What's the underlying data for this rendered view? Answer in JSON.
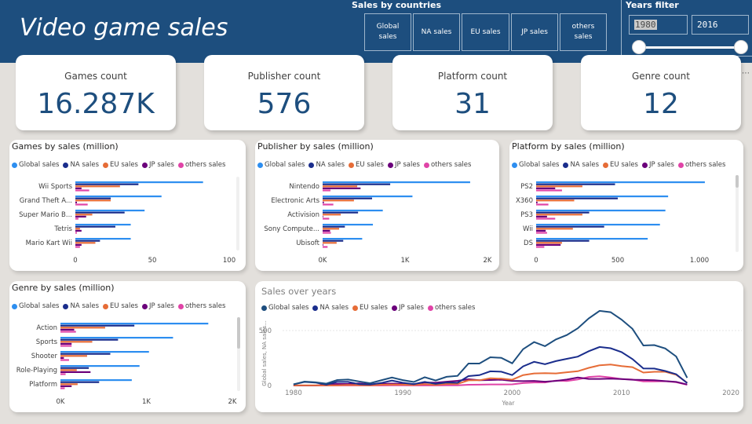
{
  "header": {
    "title": "Video game sales",
    "sales_by_countries": {
      "title": "Sales by countries",
      "buttons": [
        "Global\nsales",
        "NA sales",
        "EU sales",
        "JP sales",
        "others\nsales"
      ]
    },
    "years_filter": {
      "title": "Years filter",
      "from": "1980",
      "to": "2016"
    }
  },
  "kpis": [
    {
      "label": "Games count",
      "value": "16.287K"
    },
    {
      "label": "Publisher count",
      "value": "576"
    },
    {
      "label": "Platform count",
      "value": "31"
    },
    {
      "label": "Genre count",
      "value": "12"
    }
  ],
  "colors": {
    "global": "#2d8ef0",
    "na": "#1a2d8c",
    "eu": "#e66c37",
    "jp": "#6b007b",
    "others": "#e044a7",
    "line_global": "#1d4e7e"
  },
  "legend": [
    "Global sales",
    "NA sales",
    "EU sales",
    "JP sales",
    "others sales"
  ],
  "chart_data": [
    {
      "type": "bar",
      "title": "Games by sales (million)",
      "categories": [
        "Wii Sports",
        "Grand Theft A...",
        "Super Mario B...",
        "Tetris",
        "Mario Kart Wii"
      ],
      "series": [
        {
          "name": "Global sales",
          "values": [
            83,
            56,
            45,
            36,
            36
          ]
        },
        {
          "name": "NA sales",
          "values": [
            41,
            23,
            32,
            26,
            16
          ]
        },
        {
          "name": "EU sales",
          "values": [
            29,
            23,
            11,
            3,
            13
          ]
        },
        {
          "name": "JP sales",
          "values": [
            4,
            1,
            7,
            4,
            4
          ]
        },
        {
          "name": "others sales",
          "values": [
            9,
            8,
            2,
            1,
            3
          ]
        }
      ],
      "xlim": [
        0,
        100
      ],
      "xticks": [
        "0",
        "50",
        "100"
      ]
    },
    {
      "type": "bar",
      "title": "Publisher by sales (million)",
      "categories": [
        "Nintendo",
        "Electronic Arts",
        "Activision",
        "Sony Compute...",
        "Ubisoft"
      ],
      "series": [
        {
          "name": "Global sales",
          "values": [
            1790,
            1090,
            730,
            610,
            480
          ]
        },
        {
          "name": "NA sales",
          "values": [
            820,
            600,
            430,
            270,
            250
          ]
        },
        {
          "name": "EU sales",
          "values": [
            420,
            380,
            220,
            200,
            170
          ]
        },
        {
          "name": "JP sales",
          "values": [
            460,
            15,
            7,
            90,
            8
          ]
        },
        {
          "name": "others sales",
          "values": [
            95,
            130,
            80,
            100,
            60
          ]
        }
      ],
      "xlim": [
        0,
        2000
      ],
      "xticks": [
        "0K",
        "1K",
        "2K"
      ]
    },
    {
      "type": "bar",
      "title": "Platform by sales (million)",
      "categories": [
        "PS2",
        "X360",
        "PS3",
        "Wii",
        "DS"
      ],
      "series": [
        {
          "name": "Global sales",
          "values": [
            1240,
            970,
            950,
            910,
            820
          ]
        },
        {
          "name": "NA sales",
          "values": [
            580,
            600,
            390,
            500,
            390
          ]
        },
        {
          "name": "EU sales",
          "values": [
            340,
            280,
            340,
            270,
            190
          ]
        },
        {
          "name": "JP sales",
          "values": [
            140,
            10,
            80,
            70,
            180
          ]
        },
        {
          "name": "others sales",
          "values": [
            190,
            90,
            140,
            80,
            60
          ]
        }
      ],
      "xlim": [
        0,
        1200
      ],
      "xticks": [
        "0",
        "500",
        "1.000"
      ]
    },
    {
      "type": "bar",
      "title": "Genre by sales (million)",
      "categories": [
        "Action",
        "Sports",
        "Shooter",
        "Role-Playing",
        "Platform"
      ],
      "series": [
        {
          "name": "Global sales",
          "values": [
            1720,
            1310,
            1030,
            920,
            830
          ]
        },
        {
          "name": "NA sales",
          "values": [
            860,
            670,
            580,
            330,
            450
          ]
        },
        {
          "name": "EU sales",
          "values": [
            520,
            370,
            310,
            190,
            200
          ]
        },
        {
          "name": "JP sales",
          "values": [
            160,
            130,
            40,
            350,
            130
          ]
        },
        {
          "name": "others sales",
          "values": [
            180,
            130,
            100,
            60,
            50
          ]
        }
      ],
      "xlim": [
        0,
        2000
      ],
      "xticks": [
        "0K",
        "1K",
        "2K"
      ]
    },
    {
      "type": "line",
      "title": "Sales over years",
      "xlabel": "Year",
      "ylabel": "Global sales, NA sales...",
      "xlim": [
        1979,
        2021
      ],
      "ylim": [
        0,
        700
      ],
      "xticks": [
        "1980",
        "1990",
        "2000",
        "2010",
        "2020"
      ],
      "yticks": [
        "0",
        "500"
      ],
      "x": [
        1980,
        1981,
        1982,
        1983,
        1984,
        1985,
        1986,
        1987,
        1988,
        1989,
        1990,
        1991,
        1992,
        1993,
        1994,
        1995,
        1996,
        1997,
        1998,
        1999,
        2000,
        2001,
        2002,
        2003,
        2004,
        2005,
        2006,
        2007,
        2008,
        2009,
        2010,
        2011,
        2012,
        2013,
        2014,
        2015,
        2016
      ],
      "series": [
        {
          "name": "Global sales",
          "values": [
            11,
            36,
            29,
            17,
            50,
            54,
            37,
            21,
            47,
            73,
            49,
            32,
            76,
            46,
            79,
            88,
            200,
            200,
            257,
            252,
            202,
            331,
            396,
            358,
            419,
            459,
            521,
            611,
            679,
            667,
            600,
            516,
            364,
            368,
            337,
            264,
            70
          ]
        },
        {
          "name": "NA sales",
          "values": [
            10,
            33,
            27,
            8,
            33,
            33,
            12,
            9,
            23,
            45,
            25,
            13,
            33,
            15,
            28,
            25,
            86,
            94,
            129,
            126,
            95,
            174,
            216,
            194,
            222,
            243,
            263,
            312,
            351,
            339,
            304,
            241,
            155,
            154,
            132,
            103,
            22
          ]
        },
        {
          "name": "EU sales",
          "values": [
            1,
            2,
            2,
            1,
            2,
            5,
            3,
            1,
            7,
            9,
            8,
            4,
            12,
            5,
            14,
            15,
            47,
            48,
            66,
            62,
            53,
            95,
            110,
            112,
            110,
            121,
            130,
            161,
            184,
            191,
            177,
            167,
            118,
            125,
            125,
            98,
            26
          ]
        },
        {
          "name": "JP sales",
          "values": [
            0,
            0,
            0,
            8,
            14,
            15,
            20,
            11,
            15,
            18,
            15,
            13,
            28,
            26,
            35,
            43,
            57,
            48,
            50,
            53,
            42,
            40,
            42,
            35,
            42,
            54,
            73,
            60,
            60,
            62,
            59,
            53,
            51,
            48,
            40,
            33,
            9
          ]
        },
        {
          "name": "others sales",
          "values": [
            0,
            0,
            0,
            0,
            1,
            1,
            2,
            1,
            1,
            2,
            2,
            1,
            2,
            1,
            2,
            2,
            7,
            8,
            10,
            10,
            11,
            22,
            28,
            28,
            45,
            41,
            55,
            78,
            84,
            73,
            59,
            54,
            37,
            38,
            39,
            30,
            7
          ]
        }
      ]
    }
  ]
}
